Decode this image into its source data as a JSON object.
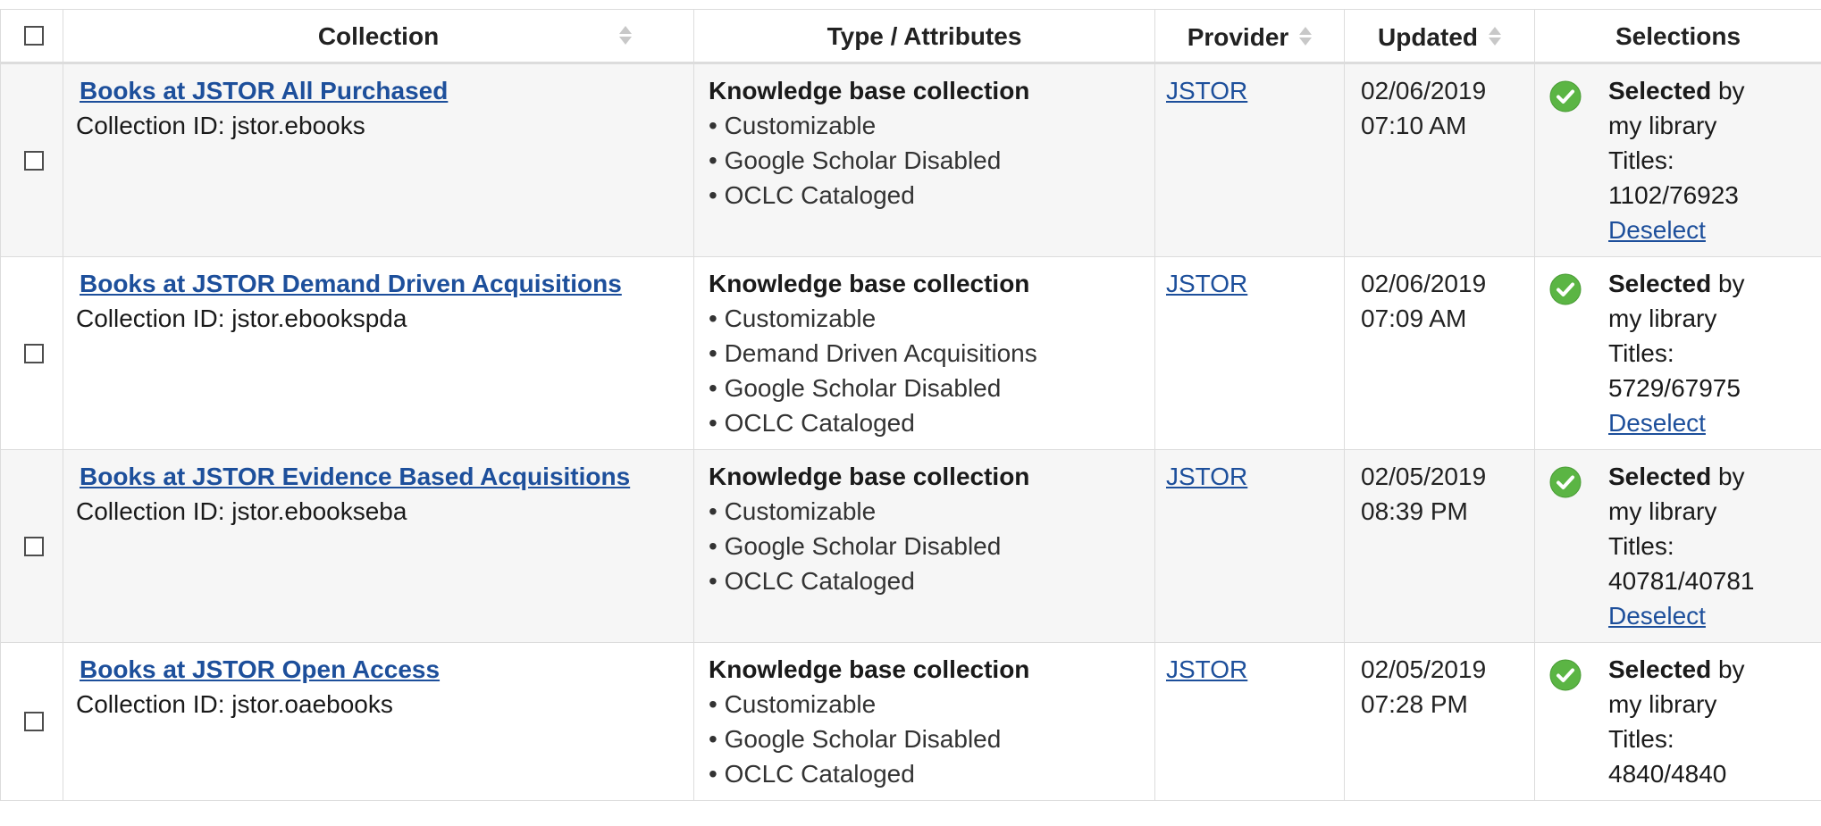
{
  "header": {
    "collection": "Collection",
    "type": "Type / Attributes",
    "provider": "Provider",
    "updated": "Updated",
    "selections": "Selections"
  },
  "rows": [
    {
      "name": "Books at JSTOR All Purchased",
      "collection_id": "Collection ID: jstor.ebooks",
      "type": "Knowledge base collection",
      "attributes": [
        "• Customizable",
        "• Google Scholar Disabled",
        "• OCLC Cataloged"
      ],
      "provider": "JSTOR",
      "date": "02/06/2019",
      "time": "07:10 AM",
      "selected_word": "Selected",
      "selected_by": " by",
      "selected_who": "my library",
      "titles_label": "Titles:",
      "titles": "1102/76923",
      "deselect": "Deselect"
    },
    {
      "name": "Books at JSTOR Demand Driven Acquisitions",
      "collection_id": "Collection ID: jstor.ebookspda",
      "type": "Knowledge base collection",
      "attributes": [
        "• Customizable",
        "• Demand Driven Acquisitions",
        "• Google Scholar Disabled",
        "• OCLC Cataloged"
      ],
      "provider": "JSTOR",
      "date": "02/06/2019",
      "time": "07:09 AM",
      "selected_word": "Selected",
      "selected_by": " by",
      "selected_who": "my library",
      "titles_label": "Titles:",
      "titles": "5729/67975",
      "deselect": "Deselect"
    },
    {
      "name": "Books at JSTOR Evidence Based Acquisitions",
      "collection_id": "Collection ID: jstor.ebookseba",
      "type": "Knowledge base collection",
      "attributes": [
        "• Customizable",
        "• Google Scholar Disabled",
        "• OCLC Cataloged"
      ],
      "provider": "JSTOR",
      "date": "02/05/2019",
      "time": "08:39 PM",
      "selected_word": "Selected",
      "selected_by": " by",
      "selected_who": "my library",
      "titles_label": "Titles:",
      "titles": "40781/40781",
      "deselect": "Deselect"
    },
    {
      "name": "Books at JSTOR Open Access",
      "collection_id": "Collection ID: jstor.oaebooks",
      "type": "Knowledge base collection",
      "attributes": [
        "• Customizable",
        "• Google Scholar Disabled",
        "• OCLC Cataloged"
      ],
      "provider": "JSTOR",
      "date": "02/05/2019",
      "time": "07:28 PM",
      "selected_word": "Selected",
      "selected_by": " by",
      "selected_who": "my library",
      "titles_label": "Titles:",
      "titles": "4840/4840",
      "deselect": ""
    }
  ],
  "icons": {
    "sort": "sort-icon",
    "selected": "check-circle-icon"
  },
  "colors": {
    "link": "#1d4f9b",
    "check_green": "#5bb544",
    "row_alt": "#f6f6f6",
    "border": "#dcdcdc"
  }
}
